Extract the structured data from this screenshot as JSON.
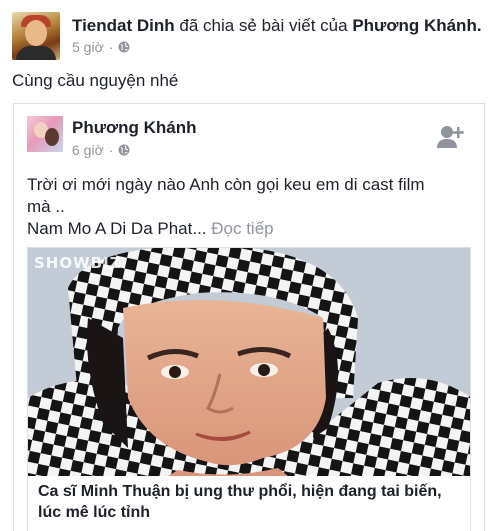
{
  "post": {
    "author": "Tiendat Dinh",
    "verb": "đã chia sẻ bài viết của",
    "shared_from": "Phương Khánh.",
    "time": "5 giờ",
    "separator": "·",
    "caption": "Cùng cầu nguyện nhé"
  },
  "shared_post": {
    "author": "Phương Khánh",
    "time": "6 giờ",
    "separator": "·",
    "text_line_1": "Trời ơi mới ngày nào Anh còn gọi keu em di cast film",
    "text_line_2": "mà ..",
    "text_line_3": "Nam Mo A Di Da Phat...",
    "see_more": "Đọc tiếp"
  },
  "link_preview": {
    "watermark": "SHOWBIZ",
    "title": "Ca sĩ Minh Thuận bị ung thư phổi, hiện đang tai biến, lúc mê lúc tỉnh"
  },
  "icons": {
    "privacy": "globe-icon",
    "add_friend": "add-friend-icon"
  },
  "colors": {
    "text": "#1d2129",
    "muted": "#90949c",
    "border": "#dddfe2"
  }
}
